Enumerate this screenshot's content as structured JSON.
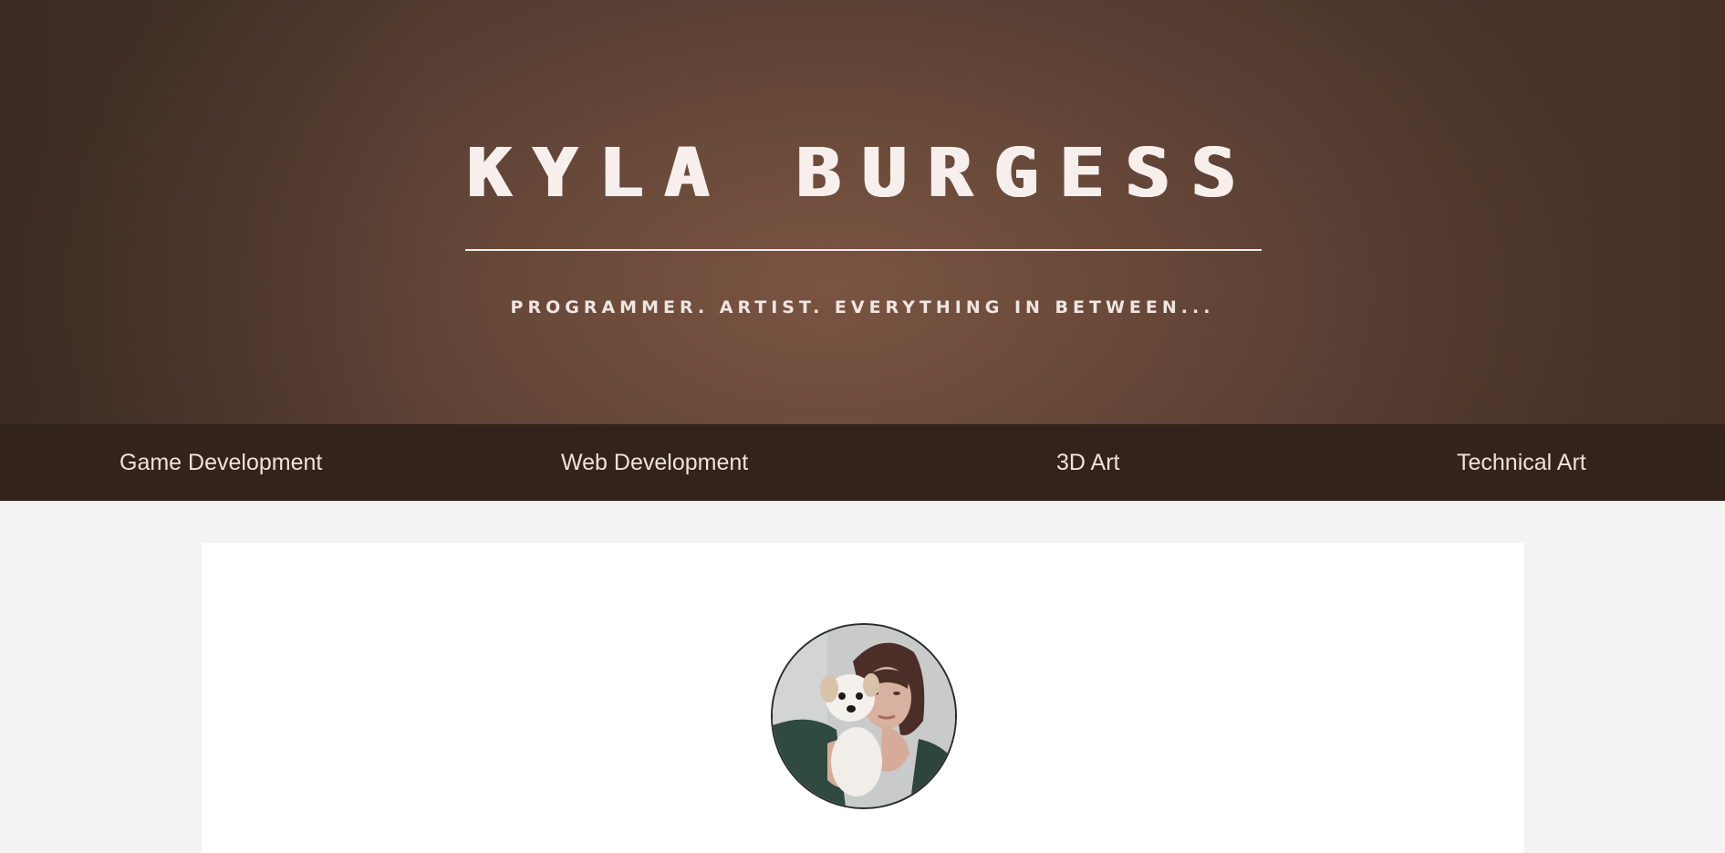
{
  "hero": {
    "title": "KYLA BURGESS",
    "tagline": "PROGRAMMER. ARTIST. EVERYTHING IN BETWEEN..."
  },
  "nav": {
    "items": [
      {
        "label": "Game Development"
      },
      {
        "label": "Web Development"
      },
      {
        "label": "3D Art"
      },
      {
        "label": "Technical Art"
      }
    ]
  },
  "colors": {
    "hero_brown": "#6c4b3b",
    "nav_background": "#32231d",
    "page_background": "#f3f3f3",
    "card_background": "#ffffff"
  }
}
